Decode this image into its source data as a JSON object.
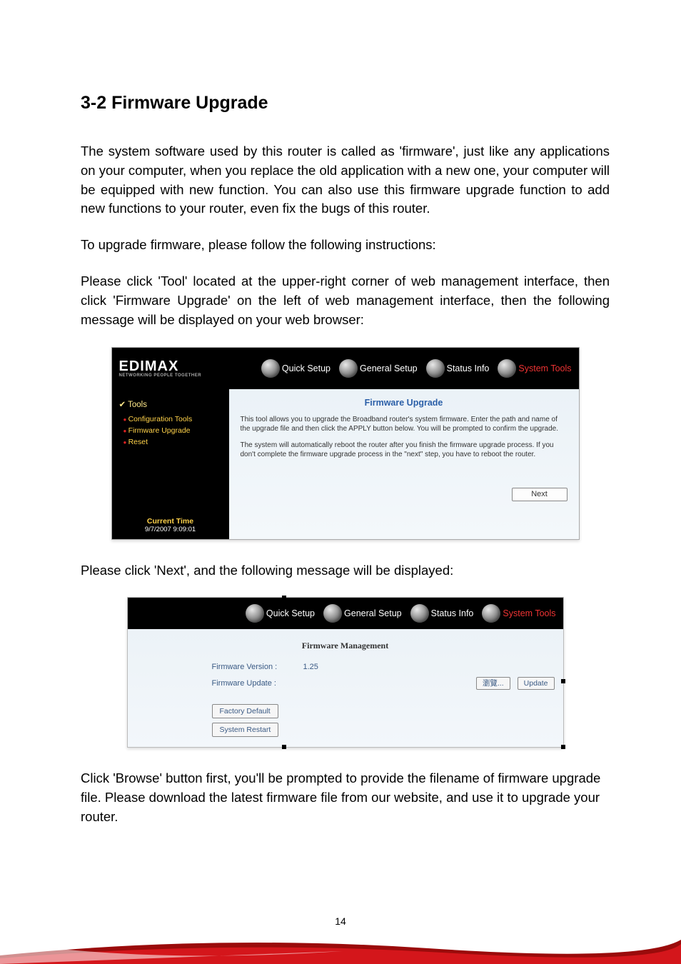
{
  "heading": "3-2 Firmware Upgrade",
  "para1": "The system software used by this router is called as 'firmware', just like any applications on your computer, when you replace the old application with a new one, your computer will be equipped with new function. You can also use this firmware upgrade function to add new functions to your router, even fix the bugs of this router.",
  "para2": "To upgrade firmware, please follow the following instructions:",
  "para3": "Please click 'Tool' located at the upper-right corner of web management interface, then click 'Firmware Upgrade' on the left of web management interface, then the following message will be displayed on your web browser:",
  "para4": "Please click 'Next', and the following message will be displayed:",
  "para5": "Click 'Browse' button first, you'll be prompted to provide the filename of firmware upgrade file. Please download the latest firmware file from our website, and use it to upgrade your router.",
  "pageNumber": "14",
  "screenshot1": {
    "logo": "EDIMAX",
    "logoSub": "NETWORKING PEOPLE TOGETHER",
    "nav": {
      "quick": "Quick Setup",
      "general": "General Setup",
      "status": "Status Info",
      "tools": "System Tools"
    },
    "sidebar": {
      "header": "✔ Tools",
      "items": [
        "Configuration Tools",
        "Firmware Upgrade",
        "Reset"
      ],
      "currentTimeLabel": "Current Time",
      "currentTimeValue": "9/7/2007 9:09:01"
    },
    "pane": {
      "title": "Firmware Upgrade",
      "p1": "This tool allows you to upgrade the Broadband router's system firmware. Enter the path and name of the upgrade file and then click the APPLY button below. You will be prompted to confirm the upgrade.",
      "p2": "The system will automatically reboot the router after you finish the firmware upgrade process. If you don't complete the firmware upgrade process in the \"next\" step, you have to reboot the router.",
      "nextBtn": "Next"
    }
  },
  "screenshot2": {
    "nav": {
      "quick": "Quick Setup",
      "general": "General Setup",
      "status": "Status Info",
      "tools": "System Tools"
    },
    "title": "Firmware Management",
    "versionLabel": "Firmware Version :",
    "versionValue": "1.25",
    "updateLabel": "Firmware Update :",
    "browseBtn": "瀏覽...",
    "updateBtn": "Update",
    "factoryBtn": "Factory Default",
    "restartBtn": "System Restart"
  }
}
